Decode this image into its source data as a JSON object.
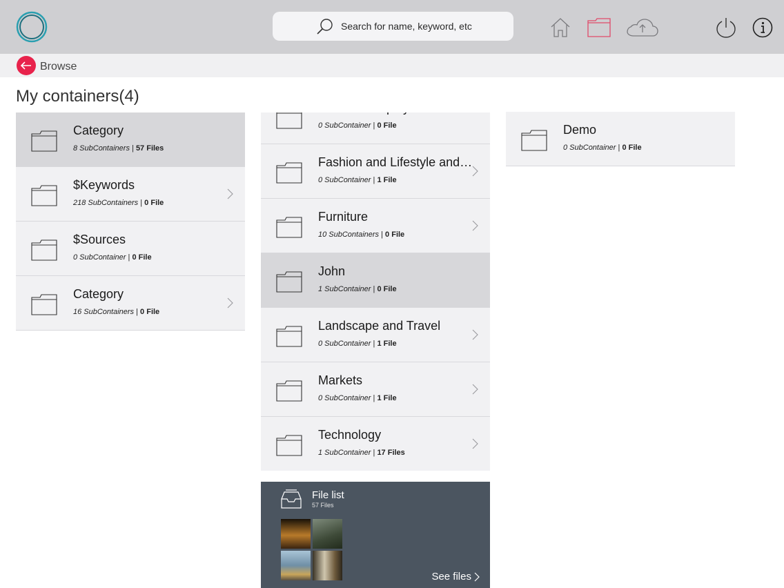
{
  "header": {
    "search_placeholder": "Search for name, keyword, etc",
    "icons": [
      "logo-icon",
      "search-icon",
      "home-icon",
      "folder-icon",
      "cloud-upload-icon",
      "power-icon",
      "info-icon"
    ],
    "accent_color": "#e8234c"
  },
  "breadcrumb": {
    "back_label": "Browse"
  },
  "page_title": "My containers(4)",
  "columns": {
    "first": [
      {
        "name": "Category",
        "sub": "8 SubContainers",
        "files": "57 Files",
        "selected": true,
        "has_chevron": false
      },
      {
        "name": "$Keywords",
        "sub": "218 SubContainers",
        "files": "0 File",
        "selected": false,
        "has_chevron": true
      },
      {
        "name": "$Sources",
        "sub": "0 SubContainer",
        "files": "0 File",
        "selected": false,
        "has_chevron": false
      },
      {
        "name": "Category",
        "sub": "16 SubContainers",
        "files": "0 File",
        "selected": false,
        "has_chevron": true
      }
    ],
    "second": [
      {
        "name": "Cumulus Deployment",
        "sub": "0 SubContainer",
        "files": "0 File",
        "selected": false,
        "has_chevron": false
      },
      {
        "name": "Fashion and Lifestyle and R...",
        "sub": "0 SubContainer",
        "files": "1 File",
        "selected": false,
        "has_chevron": true
      },
      {
        "name": "Furniture",
        "sub": "10 SubContainers",
        "files": "0 File",
        "selected": false,
        "has_chevron": true
      },
      {
        "name": "John",
        "sub": "1 SubContainer",
        "files": "0 File",
        "selected": true,
        "has_chevron": false
      },
      {
        "name": "Landscape and Travel",
        "sub": "0 SubContainer",
        "files": "1 File",
        "selected": false,
        "has_chevron": true
      },
      {
        "name": "Markets",
        "sub": "0 SubContainer",
        "files": "1 File",
        "selected": false,
        "has_chevron": true
      },
      {
        "name": "Technology",
        "sub": "1 SubContainer",
        "files": "17 Files",
        "selected": false,
        "has_chevron": true
      }
    ],
    "third": [
      {
        "name": "Demo",
        "sub": "0 SubContainer",
        "files": "0 File",
        "selected": false,
        "has_chevron": false
      }
    ]
  },
  "file_list": {
    "title": "File list",
    "count": "57 Files",
    "see_files": "See files"
  }
}
